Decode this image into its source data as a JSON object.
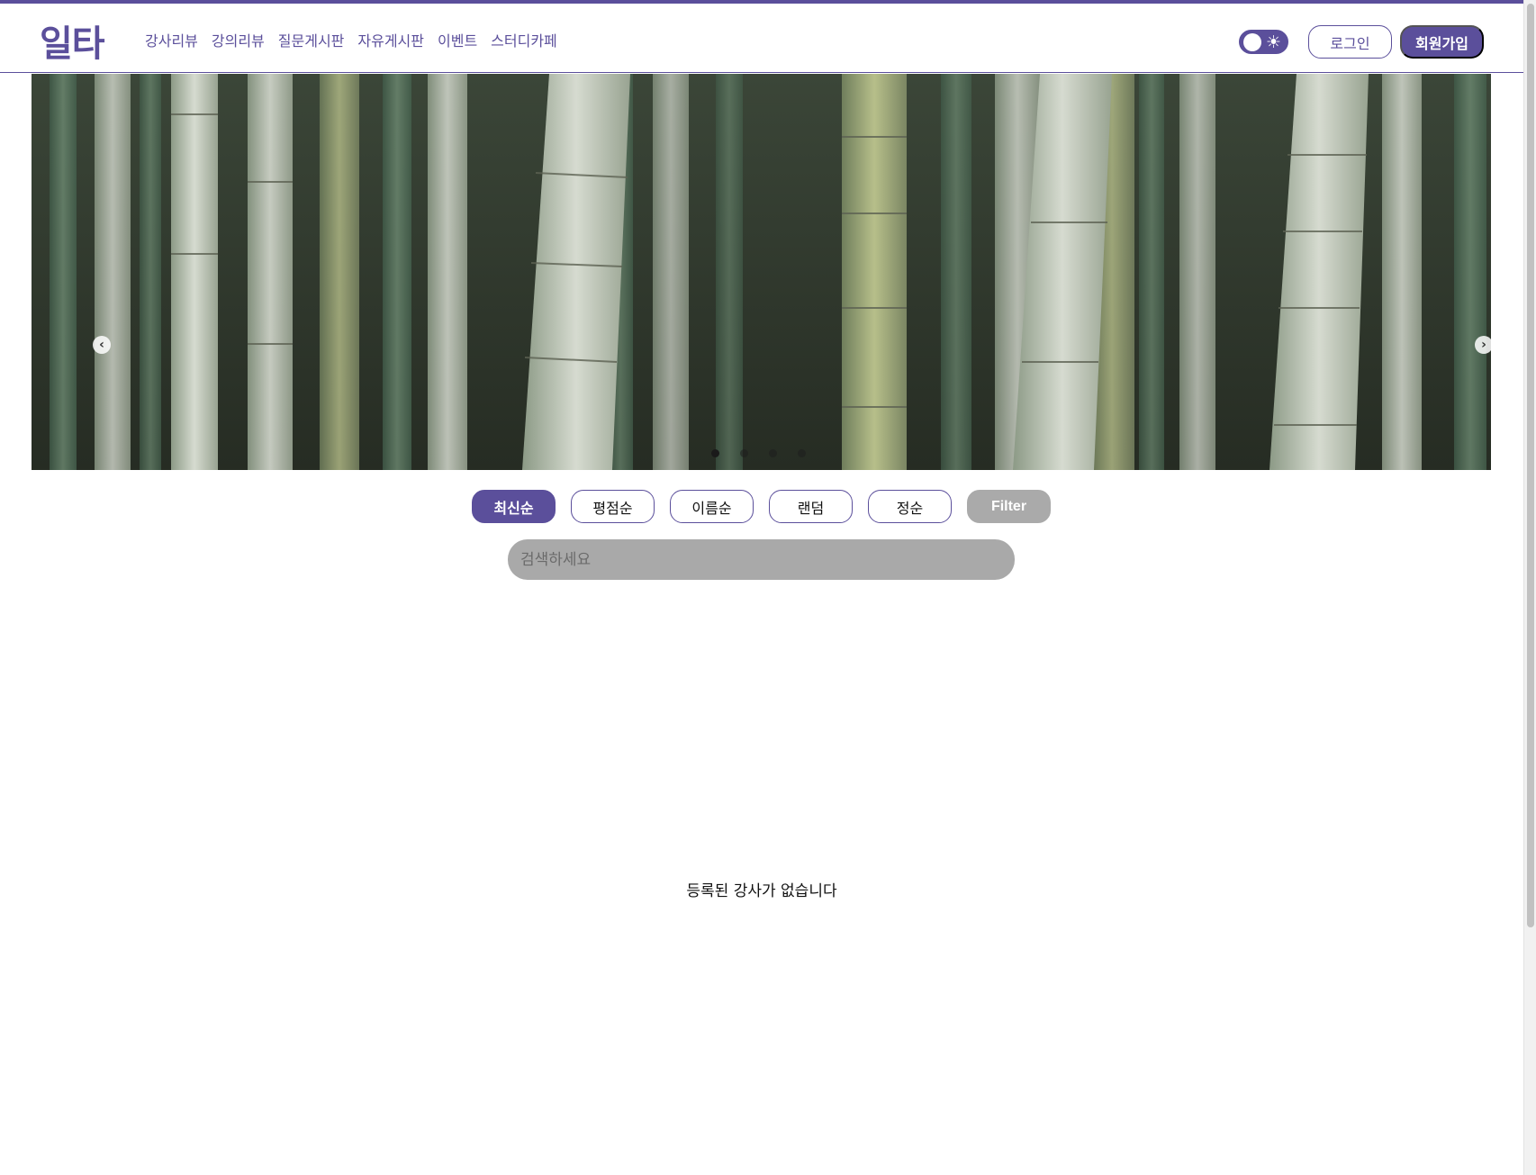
{
  "header": {
    "logo": "일타",
    "nav": [
      "강사리뷰",
      "강의리뷰",
      "질문게시판",
      "자유게시판",
      "이벤트",
      "스터디카페"
    ],
    "theme_toggle_icon": "sun-icon",
    "login_label": "로그인",
    "signup_label": "회원가입",
    "accent_color": "#5b4f9b"
  },
  "carousel": {
    "image": "bamboo forest",
    "prev_icon": "chevron-left-icon",
    "next_icon": "chevron-right-icon",
    "slide_count": 4,
    "active_slide": 1
  },
  "sort": {
    "options": [
      "최신순",
      "평점순",
      "이름순",
      "랜덤",
      "정순"
    ],
    "active": "최신순",
    "filter_label": "Filter"
  },
  "search": {
    "placeholder": "검색하세요"
  },
  "content": {
    "empty_message": "등록된 강사가 없습니다"
  }
}
